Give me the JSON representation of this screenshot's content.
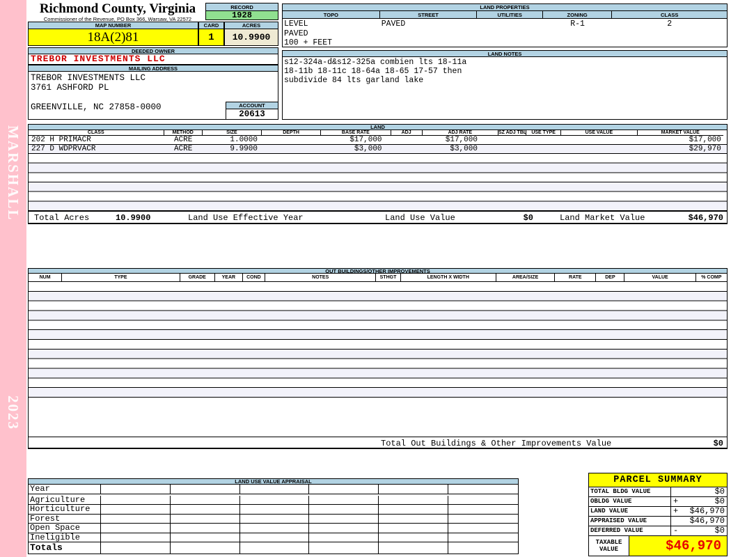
{
  "colors": {
    "band_pink": "#FFC1CC",
    "header_blue": "#B2D3E3",
    "record_green": "#90E090",
    "highlight_yellow": "#FFFF00",
    "acres_cream": "#EFEAD3",
    "owner_red": "#CC0000",
    "taxable_red": "#E80000",
    "row_alt": "#F2F2FA"
  },
  "sideband": {
    "vendor": "MARSHALL",
    "year": "2023"
  },
  "header": {
    "county": "Richmond County, Virginia",
    "commissioner": "Commissioner of the Revenue, PO Box 366, Warsaw, VA 22572",
    "record_label": "RECORD",
    "record": "1928",
    "map_number_label": "MAP NUMBER",
    "map_number": "18A(2)81",
    "card_label": "CARD",
    "card": "1",
    "acres_label": "ACRES",
    "acres": "10.9900"
  },
  "land_properties": {
    "title": "LAND PROPERTIES",
    "columns": [
      "TOPO",
      "STREET",
      "UTILITIES",
      "ZONING",
      "CLASS"
    ],
    "topo_lines": "LEVEL\nPAVED\n100 + FEET",
    "street": "PAVED",
    "utilities": "",
    "zoning": "R-1",
    "class": "2"
  },
  "owner": {
    "deeded_owner_label": "DEEDED OWNER",
    "deeded_owner": "TREBOR INVESTMENTS LLC",
    "mailing_address_label": "MAILING ADDRESS",
    "address_line1": "TREBOR INVESTMENTS LLC",
    "address_line2": "3761 ASHFORD PL",
    "address_line3": "",
    "address_line4": "GREENVILLE, NC 27858-0000",
    "account_label": "ACCOUNT",
    "account": "20613"
  },
  "land_notes": {
    "title": "LAND NOTES",
    "lines": "s12-324a-d&s12-325a combien lts 18-11a\n18-11b 18-11c 18-64a 18-65 17-57 then\nsubdivide 84 lts garland lake"
  },
  "land": {
    "title": "LAND",
    "columns": [
      "CLASS",
      "METHOD",
      "SIZE",
      "DEPTH",
      "BASE RATE",
      "ADJ",
      "ADJ RATE",
      "SZ ADJ TBL",
      "USE TYPE",
      "USE VALUE",
      "MARKET VALUE"
    ],
    "rows": [
      {
        "class": "202 H PRIMACR",
        "method": "ACRE",
        "size": "1.0000",
        "depth": "",
        "base_rate": "$17,000",
        "adj": "",
        "adj_rate": "$17,000",
        "sz_adj_tbl": "",
        "use_type": "",
        "use_value": "",
        "market_value": "$17,000"
      },
      {
        "class": "227 D WDPRVACR",
        "method": "ACRE",
        "size": "9.9900",
        "depth": "",
        "base_rate": "$3,000",
        "adj": "",
        "adj_rate": "$3,000",
        "sz_adj_tbl": "",
        "use_type": "",
        "use_value": "",
        "market_value": "$29,970"
      }
    ],
    "totals": {
      "total_acres_label": "Total Acres",
      "total_acres": "10.9900",
      "effective_year_label": "Land Use Effective Year",
      "use_value_label": "Land Use Value",
      "use_value": "$0",
      "market_value_label": "Land Market Value",
      "market_value": "$46,970"
    }
  },
  "out_buildings": {
    "title": "OUT BUILDINGS/OTHER IMPROVEMENTS",
    "columns": [
      "NUM",
      "TYPE",
      "GRADE",
      "YEAR",
      "COND",
      "NOTES",
      "STHGT",
      "LENGTH X WIDTH",
      "AREA/SIZE",
      "RATE",
      "DEP",
      "VALUE",
      "% COMP"
    ],
    "total_label": "Total Out Buildings & Other Improvements Value",
    "total": "$0"
  },
  "land_use_appraisal": {
    "title": "LAND USE VALUE APPRAISAL",
    "row_labels": [
      "Year",
      "Agriculture",
      "Horticulture",
      "Forest",
      "Open Space",
      "Ineligible",
      "Totals"
    ]
  },
  "parcel_summary": {
    "title": "PARCEL SUMMARY",
    "rows": [
      {
        "label": "TOTAL BLDG VALUE",
        "sign": "",
        "value": "$0"
      },
      {
        "label": "OBLDG VALUE",
        "sign": "+",
        "value": "$0"
      },
      {
        "label": "LAND VALUE",
        "sign": "+",
        "value": "$46,970"
      },
      {
        "label": "APPRAISED VALUE",
        "sign": "",
        "value": "$46,970"
      },
      {
        "label": "DEFERRED VALUE",
        "sign": "-",
        "value": "$0"
      }
    ],
    "taxable_label": "TAXABLE\nVALUE",
    "taxable_value": "$46,970"
  }
}
